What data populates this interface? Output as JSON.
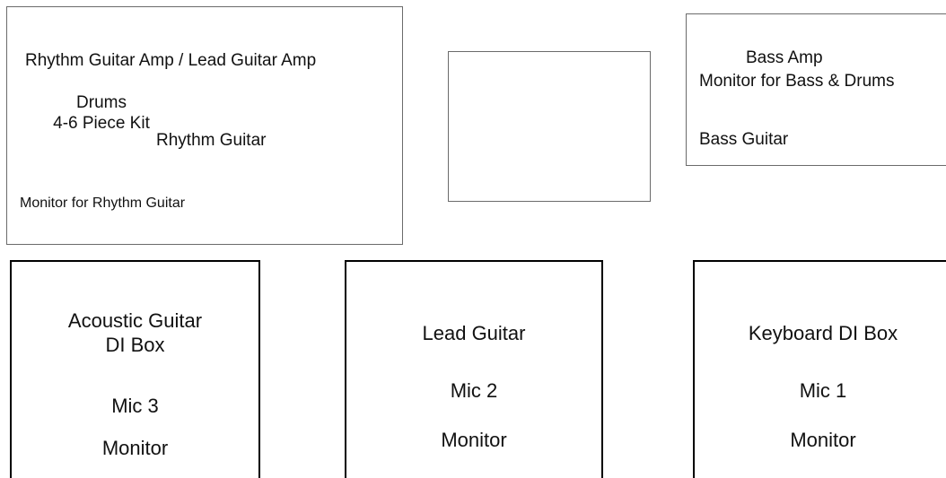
{
  "rhythm_area": {
    "amps": "Rhythm Guitar Amp / Lead Guitar Amp",
    "player": "Rhythm Guitar",
    "monitor": "Monitor for Rhythm Guitar"
  },
  "drums_area": {
    "line1": "Drums",
    "line2": "4-6 Piece Kit"
  },
  "bass_area": {
    "amp": "Bass Amp",
    "monitor": "Monitor for Bass & Drums",
    "player": "Bass Guitar"
  },
  "acoustic_area": {
    "title_line1": "Acoustic Guitar",
    "title_line2": "DI Box",
    "mic": "Mic 3",
    "monitor": "Monitor"
  },
  "lead_area": {
    "title": "Lead Guitar",
    "mic": "Mic 2",
    "monitor": "Monitor"
  },
  "keys_area": {
    "title": "Keyboard DI Box",
    "mic": "Mic 1",
    "monitor": "Monitor"
  }
}
